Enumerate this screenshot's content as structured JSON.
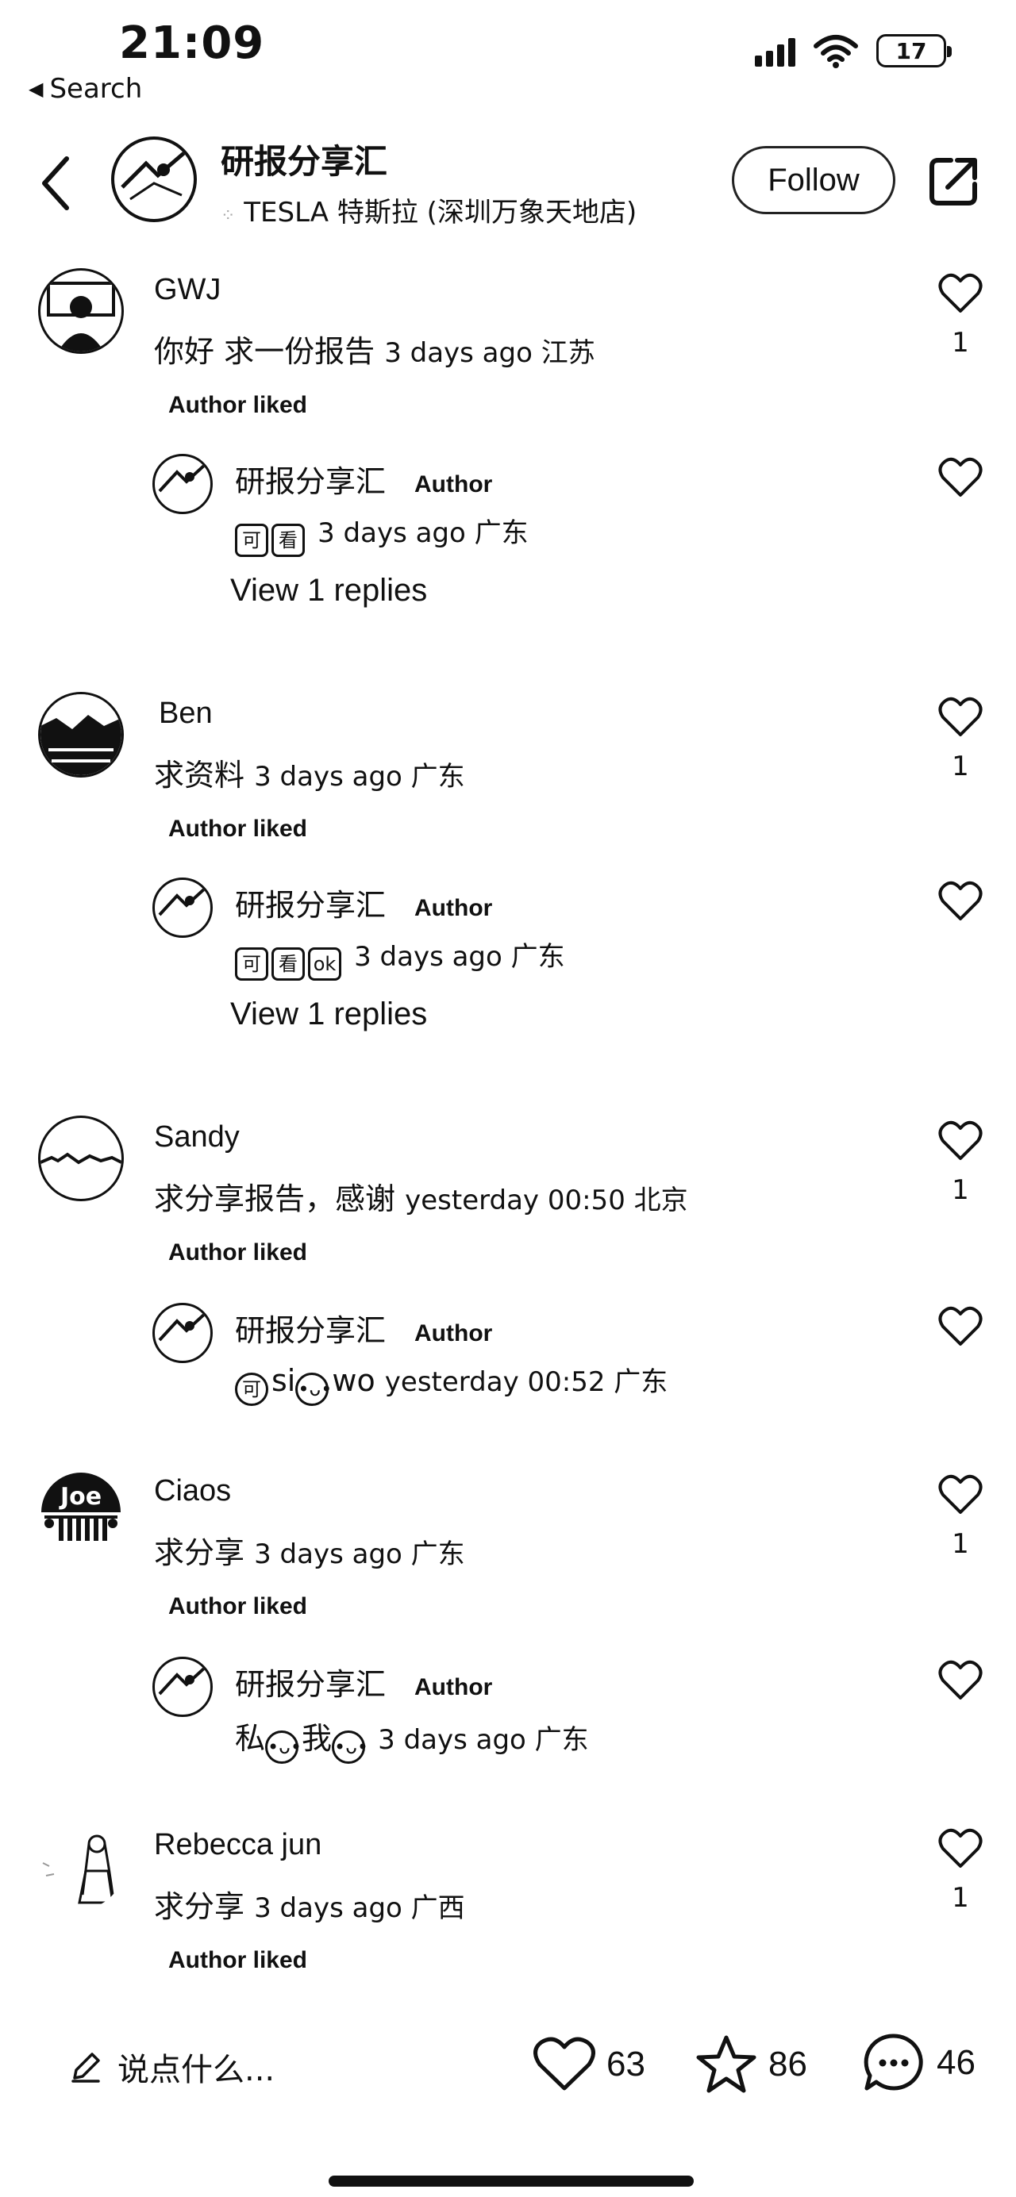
{
  "status_bar": {
    "time": "21:09",
    "back_app": "Search",
    "battery": "17"
  },
  "header": {
    "title": "研报分享汇",
    "subtitle": "TESLA 特斯拉 (深圳万象天地店)",
    "follow_label": "Follow"
  },
  "comments": [
    {
      "name": "GWJ",
      "text": "你好 求一份报告",
      "meta": "3 days ago 江苏",
      "likes": "1",
      "author_liked": "Author liked",
      "reply": {
        "name": "研报分享汇",
        "tag": "Author",
        "text": "",
        "meta": "3 days ago 广东",
        "view_replies": "View 1 replies"
      }
    },
    {
      "name": "Ben",
      "text": "求资料",
      "meta": "3 days ago 广东",
      "likes": "1",
      "author_liked": "Author liked",
      "reply": {
        "name": "研报分享汇",
        "tag": "Author",
        "text": "",
        "meta": "3 days ago 广东",
        "view_replies": "View 1 replies"
      }
    },
    {
      "name": "Sandy",
      "text": "求分享报告，感谢",
      "meta": "yesterday 00:50 北京",
      "likes": "1",
      "author_liked": "Author liked",
      "reply": {
        "name": "研报分享汇",
        "tag": "Author",
        "text_a": "si",
        "text_b": "wo",
        "meta": "yesterday 00:52 广东"
      }
    },
    {
      "name": "Ciaos",
      "avatar_text": "Joe",
      "text": "求分享",
      "meta": "3 days ago 广东",
      "likes": "1",
      "author_liked": "Author liked",
      "reply": {
        "name": "研报分享汇",
        "tag": "Author",
        "text_a": "私",
        "text_b": "我",
        "meta": "3 days ago 广东"
      }
    },
    {
      "name": "Rebecca jun",
      "text": "求分享",
      "meta": "3 days ago 广西",
      "likes": "1",
      "author_liked": "Author liked"
    }
  ],
  "bottom_bar": {
    "compose_placeholder": "说点什么...",
    "likes": "63",
    "favorites": "86",
    "comments": "46"
  }
}
